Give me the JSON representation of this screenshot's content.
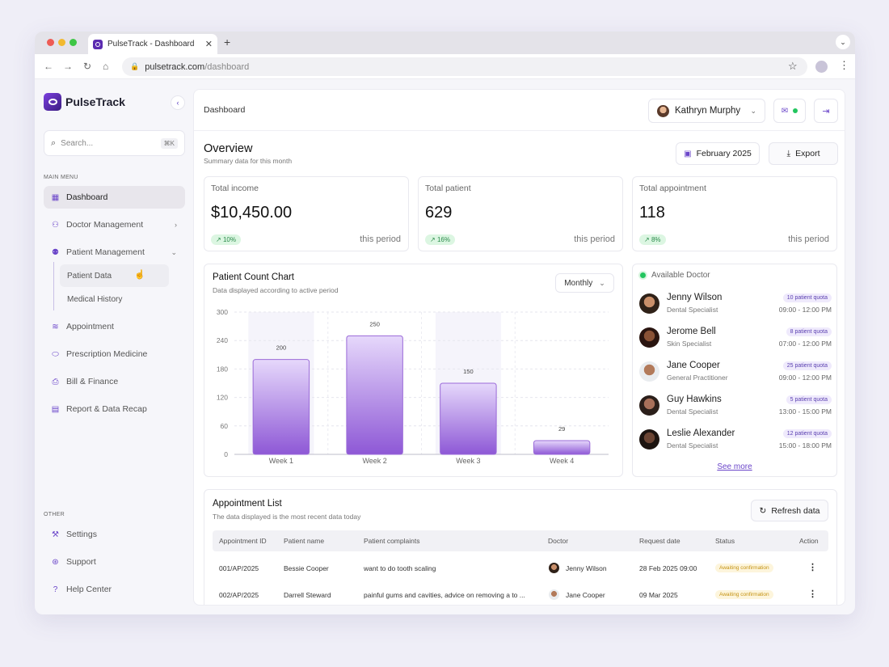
{
  "browser": {
    "tab_title": "PulseTrack - Dashboard",
    "url_host": "pulsetrack.com",
    "url_path": "/dashboard"
  },
  "sidebar": {
    "brand": "PulseTrack",
    "search_placeholder": "Search...",
    "search_shortcut": "⌘K",
    "main_menu_label": "MAIN MENU",
    "items": [
      {
        "label": "Dashboard",
        "icon": "grid-icon"
      },
      {
        "label": "Doctor Management",
        "icon": "user-check-icon"
      },
      {
        "label": "Patient Management",
        "icon": "users-icon"
      },
      {
        "label": "Appointment",
        "icon": "layers-icon"
      },
      {
        "label": "Prescription Medicine",
        "icon": "pill-icon"
      },
      {
        "label": "Bill & Finance",
        "icon": "printer-icon"
      },
      {
        "label": "Report & Data Recap",
        "icon": "file-icon"
      }
    ],
    "sub_items": [
      "Patient Data",
      "Medical History"
    ],
    "other_label": "OTHER",
    "other_items": [
      {
        "label": "Settings",
        "icon": "wrench-icon"
      },
      {
        "label": "Support",
        "icon": "lifebuoy-icon"
      },
      {
        "label": "Help Center",
        "icon": "help-circle-icon"
      }
    ]
  },
  "header": {
    "breadcrumb": "Dashboard",
    "user_name": "Kathryn Murphy"
  },
  "overview": {
    "title": "Overview",
    "subtitle": "Summary data for this month",
    "date_button": "February 2025",
    "export_button": "Export"
  },
  "stats": [
    {
      "label": "Total income",
      "value": "$10,450.00",
      "change": "10%",
      "period": "this period"
    },
    {
      "label": "Total patient",
      "value": "629",
      "change": "16%",
      "period": "this period"
    },
    {
      "label": "Total appointment",
      "value": "118",
      "change": "8%",
      "period": "this period"
    }
  ],
  "chart_card": {
    "title": "Patient Count Chart",
    "subtitle": "Data displayed according to active period",
    "period_select": "Monthly"
  },
  "chart_data": {
    "type": "bar",
    "categories": [
      "Week 1",
      "Week 2",
      "Week 3",
      "Week 4"
    ],
    "values": [
      200,
      250,
      150,
      29
    ],
    "ylim": [
      0,
      300
    ],
    "yticks": [
      0,
      60,
      120,
      180,
      240,
      300
    ],
    "grid": true,
    "bar_color": "#8e58d6"
  },
  "doctors": {
    "header": "Available Doctor",
    "see_more": "See more",
    "list": [
      {
        "name": "Jenny Wilson",
        "specialty": "Dental Specialist",
        "quota": "10 patient quota",
        "time": "09:00 - 12:00 PM"
      },
      {
        "name": "Jerome Bell",
        "specialty": "Skin Specialist",
        "quota": "8 patient quota",
        "time": "07:00 - 12:00 PM"
      },
      {
        "name": "Jane Cooper",
        "specialty": "General Practitioner",
        "quota": "25 patient quota",
        "time": "09:00 - 12:00 PM"
      },
      {
        "name": "Guy Hawkins",
        "specialty": "Dental Specialist",
        "quota": "5 patient quota",
        "time": "13:00 - 15:00 PM"
      },
      {
        "name": "Leslie Alexander",
        "specialty": "Dental Specialist",
        "quota": "12 patient quota",
        "time": "15:00 - 18:00 PM"
      }
    ]
  },
  "appointments": {
    "title": "Appointment List",
    "subtitle": "The data displayed is the most recent data today",
    "refresh_button": "Refresh data",
    "columns": [
      "Appointment ID",
      "Patient name",
      "Patient complaints",
      "Doctor",
      "Request date",
      "Status",
      "Action"
    ],
    "rows": [
      {
        "id": "001/AP/2025",
        "patient": "Bessie Cooper",
        "complaint": "want to do tooth scaling",
        "doctor": "Jenny Wilson",
        "date": "28 Feb 2025 09:00",
        "status": "Awaiting confirmation"
      },
      {
        "id": "002/AP/2025",
        "patient": "Darrell Steward",
        "complaint": "painful gums and cavities, advice on removing a to ...",
        "doctor": "Jane Cooper",
        "date": "09 Mar 2025",
        "status": "Awaiting confirmation"
      }
    ]
  }
}
